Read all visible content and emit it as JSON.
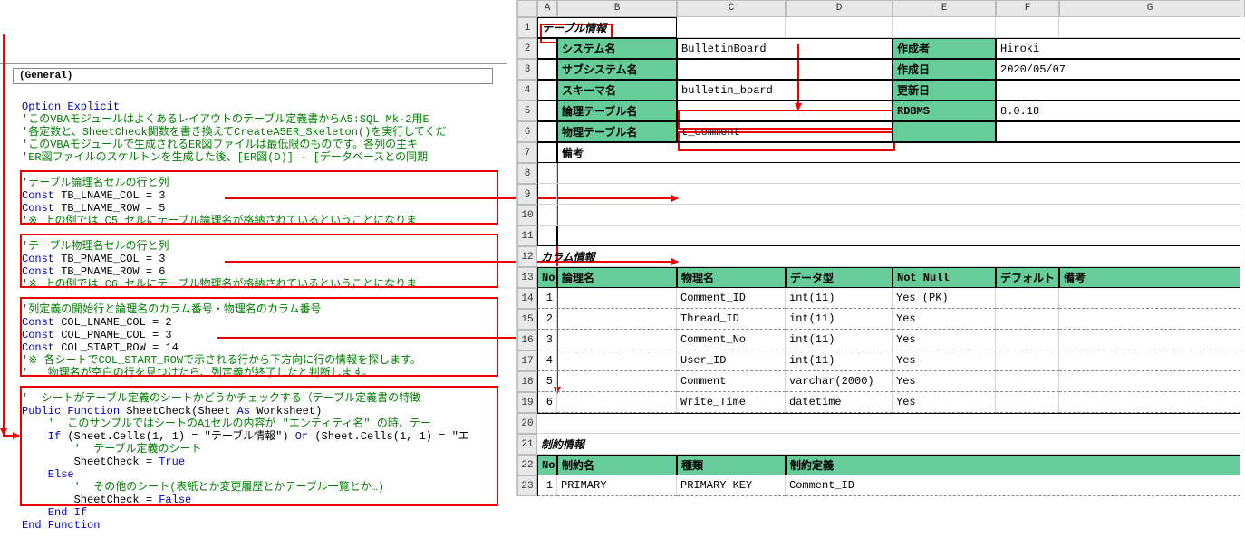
{
  "code_panel": {
    "dropdown_label": "(General)",
    "line1": "Option Explicit",
    "line2": "'このVBAモジュールはよくあるレイアウトのテーブル定義書からA5:SQL Mk-2用E",
    "line3": "'各定数と、SheetCheck関数を書き換えてCreateA5ER_Skeleton()を実行してくだ",
    "line4": "'このVBAモジュールで生成されるER図ファイルは最低限のものです。各列の主キ",
    "line5": "'ER図ファイルのスケルトンを生成した後、[ER図(D)] - [データベースとの同期",
    "blockA_l1": "'テーブル論理名セルの行と列",
    "blockA_l2a": "Const",
    "blockA_l2b": " TB_LNAME_COL = 3",
    "blockA_l3a": "Const",
    "blockA_l3b": " TB_LNAME_ROW = 5",
    "blockA_l4": "'※ 上の例では C5 セルにテーブル論理名が格納されているということになりま",
    "blockB_l1": "'テーブル物理名セルの行と列",
    "blockB_l2a": "Const",
    "blockB_l2b": " TB_PNAME_COL = 3",
    "blockB_l3a": "Const",
    "blockB_l3b": " TB_PNAME_ROW = 6",
    "blockB_l4": "'※ 上の例では C6 セルにテーブル物理名が格納されているということになりま",
    "blockC_l1": "'列定義の開始行と論理名のカラム番号・物理名のカラム番号",
    "blockC_l2a": "Const",
    "blockC_l2b": " COL_LNAME_COL = 2",
    "blockC_l3a": "Const",
    "blockC_l3b": " COL_PNAME_COL = 3",
    "blockC_l4a": "Const",
    "blockC_l4b": " COL_START_ROW = 14",
    "blockC_l5": "'※ 各シートでCOL_START_ROWで示される行から下方向に行の情報を探します。",
    "blockC_l6": "'   物理名が空白の行を見つけたら、列定義が終了したと判断します。",
    "blockD_l1": "'  シートがテーブル定義のシートかどうかチェックする（テーブル定義書の特徴",
    "blockD_l2a": "Public Function",
    "blockD_l2b": " SheetCheck(Sheet ",
    "blockD_l2c": "As",
    "blockD_l2d": " Worksheet)",
    "blockD_l3": "    '  このサンプルではシートのA1セルの内容が \"エンティティ名\" の時、テー",
    "blockD_l4a": "    If",
    "blockD_l4b": " (Sheet.Cells(1, 1) = \"テーブル情報\") ",
    "blockD_l4c": "Or",
    "blockD_l4d": " (Sheet.Cells(1, 1) = \"エ",
    "blockD_l5": "        '  テーブル定義のシート",
    "blockD_l6a": "        SheetCheck = ",
    "blockD_l6b": "True",
    "blockD_l7": "    Else",
    "blockD_l8": "        '  その他のシート(表紙とか変更履歴とかテーブル一覧とか…)",
    "blockD_l9a": "        SheetCheck = ",
    "blockD_l9b": "False",
    "blockD_l10": "    End If",
    "blockD_l11": "End Function"
  },
  "sheet": {
    "cols": [
      "A",
      "B",
      "C",
      "D",
      "E",
      "F",
      "G"
    ],
    "section_table": "テーブル情報",
    "labels": {
      "system": "システム名",
      "subsystem": "サブシステム名",
      "schema": "スキーマ名",
      "logical": "論理テーブル名",
      "physical": "物理テーブル名",
      "remark": "備考",
      "creator": "作成者",
      "created": "作成日",
      "updated": "更新日",
      "rdbms": "RDBMS"
    },
    "vals": {
      "system": "BulletinBoard",
      "schema": "bulletin_board",
      "physical": "t_comment",
      "creator": "Hiroki",
      "created": "2020/05/07",
      "rdbms": "8.0.18"
    },
    "section_column": "カラム情報",
    "colhdrs": {
      "no": "No.",
      "lname": "論理名",
      "pname": "物理名",
      "dtype": "データ型",
      "nn": "Not Null",
      "def": "デフォルト",
      "rem": "備考"
    },
    "coldata": [
      {
        "no": "1",
        "lname": "",
        "pname": "Comment_ID",
        "dtype": "int(11)",
        "nn": "Yes (PK)"
      },
      {
        "no": "2",
        "lname": "",
        "pname": "Thread_ID",
        "dtype": "int(11)",
        "nn": "Yes"
      },
      {
        "no": "3",
        "lname": "",
        "pname": "Comment_No",
        "dtype": "int(11)",
        "nn": "Yes"
      },
      {
        "no": "4",
        "lname": "",
        "pname": "User_ID",
        "dtype": "int(11)",
        "nn": "Yes"
      },
      {
        "no": "5",
        "lname": "",
        "pname": "Comment",
        "dtype": "varchar(2000)",
        "nn": "Yes"
      },
      {
        "no": "6",
        "lname": "",
        "pname": "Write_Time",
        "dtype": "datetime",
        "nn": "Yes"
      }
    ],
    "section_constraint": "制約情報",
    "cnhdrs": {
      "no": "No.",
      "name": "制約名",
      "kind": "種類",
      "def": "制約定義"
    },
    "cndata": [
      {
        "no": "1",
        "name": "PRIMARY",
        "kind": "PRIMARY KEY",
        "def": "Comment_ID"
      }
    ]
  }
}
